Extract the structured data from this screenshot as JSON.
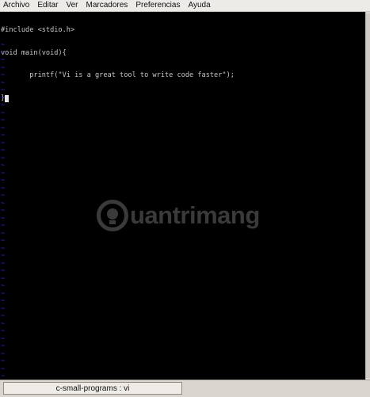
{
  "menubar": {
    "items": [
      "Archivo",
      "Editar",
      "Ver",
      "Marcadores",
      "Preferencias",
      "Ayuda"
    ]
  },
  "editor": {
    "lines": [
      "#include <stdio.h>",
      "void main(void){",
      "       printf(\"Vi is a great tool to write code faster\");",
      "}"
    ],
    "empty_line_marker": "~",
    "empty_line_count": 46,
    "text_color": "#c8c8c8",
    "tilde_color": "#2b2bd6",
    "background": "#000000"
  },
  "watermark": {
    "text": "uantrimang"
  },
  "taskbar": {
    "window_title": "c-small-programs : vi"
  }
}
